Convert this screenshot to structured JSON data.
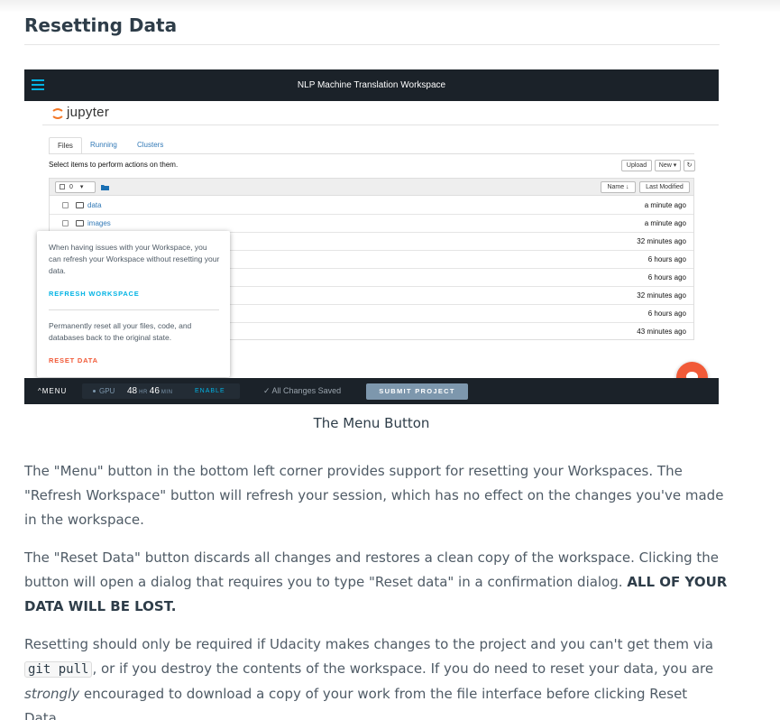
{
  "section": {
    "title": "Resetting Data"
  },
  "screenshot": {
    "topbar_title": "NLP Machine Translation Workspace",
    "jupyter_name": "jupyter",
    "tabs": [
      "Files",
      "Running",
      "Clusters"
    ],
    "select_hint": "Select items to perform actions on them.",
    "upload_label": "Upload",
    "new_label": "New ▾",
    "refresh_glyph": "↻",
    "select_count": "0",
    "sort_name": "Name ↓",
    "sort_modified": "Last Modified",
    "rows": [
      {
        "name": "data",
        "modified": "a minute ago"
      },
      {
        "name": "images",
        "modified": "a minute ago"
      },
      {
        "name": "",
        "modified": "32 minutes ago"
      },
      {
        "name": "",
        "modified": "6 hours ago"
      },
      {
        "name": "",
        "modified": "6 hours ago"
      },
      {
        "name": "",
        "modified": "32 minutes ago"
      },
      {
        "name": "",
        "modified": "6 hours ago"
      },
      {
        "name": "",
        "modified": "43 minutes ago"
      }
    ],
    "popover": {
      "refresh_text": "When having issues with your Workspace, you can refresh your Workspace without resetting your data.",
      "refresh_link": "REFRESH WORKSPACE",
      "reset_text": "Permanently reset all your files, code, and databases back to the original state.",
      "reset_link": "RESET DATA"
    },
    "bottombar": {
      "menu_label": "^MENU",
      "gpu_label": "GPU",
      "hours": "48",
      "hr_unit": "HR",
      "minutes": "46",
      "min_unit": "MIN",
      "enable_label": "ENABLE",
      "saved_label": "✓ All Changes Saved",
      "submit_label": "SUBMIT PROJECT"
    },
    "colors": {
      "accent": "#02b3e4",
      "danger": "#f15a38",
      "bar": "#1b2229"
    }
  },
  "caption": "The Menu Button",
  "paragraphs": {
    "p1": "The \"Menu\" button in the bottom left corner provides support for resetting your Workspaces. The \"Refresh Workspace\" button will refresh your session, which has no effect on the changes you've made in the workspace.",
    "p2_main": "The \"Reset Data\" button discards all changes and restores a clean copy of the workspace. Clicking the button will open a dialog that requires you to type \"Reset data\" in a confirmation dialog. ",
    "p2_bold": "ALL OF YOUR DATA WILL BE LOST.",
    "p3_a": "Resetting should only be required if Udacity makes changes to the project and you can't get them via ",
    "p3_code": "git pull",
    "p3_b": ", or if you destroy the contents of the workspace. If you do need to reset your data, you are ",
    "p3_em": "strongly",
    "p3_c": " encouraged to download a copy of your work from the file interface before clicking Reset Data."
  }
}
